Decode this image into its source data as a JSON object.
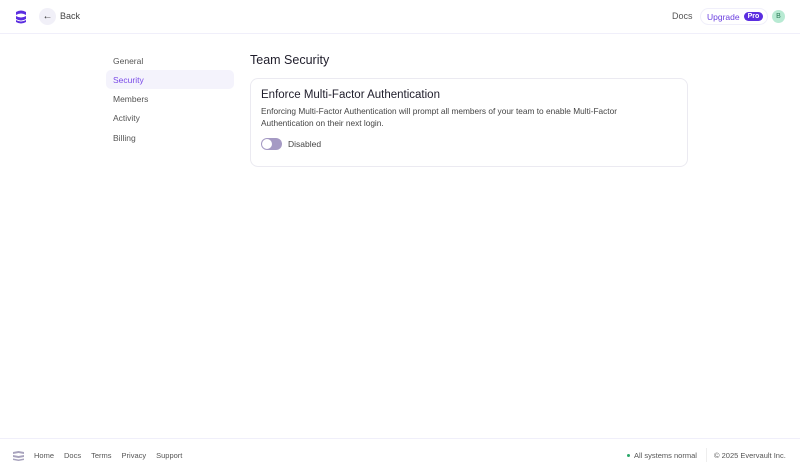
{
  "header": {
    "back_label": "Back",
    "docs_label": "Docs",
    "upgrade_label": "Upgrade",
    "pro_badge": "Pro",
    "avatar_initial": "B"
  },
  "sidebar": {
    "items": [
      {
        "label": "General"
      },
      {
        "label": "Security"
      },
      {
        "label": "Members"
      },
      {
        "label": "Activity"
      },
      {
        "label": "Billing"
      }
    ]
  },
  "main": {
    "title": "Team Security",
    "card": {
      "heading": "Enforce Multi-Factor Authentication",
      "description": "Enforcing Multi-Factor Authentication will prompt all members of your team to enable Multi-Factor Authentication on their next login.",
      "toggle_state": "Disabled"
    }
  },
  "footer": {
    "links": [
      "Home",
      "Docs",
      "Terms",
      "Privacy",
      "Support"
    ],
    "status": "All systems normal",
    "copyright": "© 2025 Evervault Inc."
  },
  "colors": {
    "accent": "#5b2ee0",
    "status": "#2aa86a"
  }
}
